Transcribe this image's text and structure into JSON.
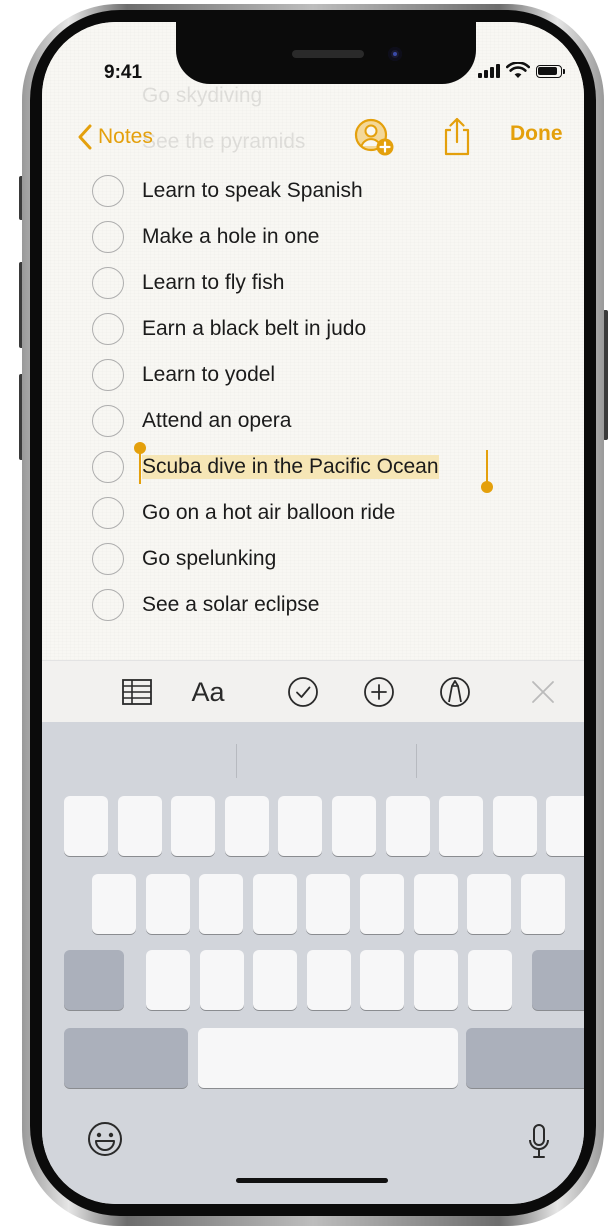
{
  "status_bar": {
    "time": "9:41"
  },
  "scrolled_items": [
    "Go skydiving",
    "See the pyramids"
  ],
  "nav": {
    "back_label": "Notes",
    "done_label": "Done"
  },
  "checklist": [
    {
      "text": "Learn to speak Spanish",
      "checked": false
    },
    {
      "text": "Make a hole in one",
      "checked": false
    },
    {
      "text": "Learn to fly fish",
      "checked": false
    },
    {
      "text": "Earn a black belt in judo",
      "checked": false
    },
    {
      "text": "Learn to yodel",
      "checked": false
    },
    {
      "text": "Attend an opera",
      "checked": false
    },
    {
      "text": "Scuba dive in the Pacific Ocean",
      "checked": false,
      "selected": true
    },
    {
      "text": "Go on a hot air balloon ride",
      "checked": false
    },
    {
      "text": "Go spelunking",
      "checked": false
    },
    {
      "text": "See a solar eclipse",
      "checked": false
    }
  ],
  "format_toolbar": {
    "text_style_label": "Aa",
    "icons": [
      "table-icon",
      "text-style-icon",
      "checklist-icon",
      "add-icon",
      "markup-icon",
      "close-icon"
    ]
  },
  "keyboard": {
    "icons": [
      "emoji-icon",
      "microphone-icon"
    ]
  },
  "colors": {
    "accent": "#e4a00c",
    "selection": "#f6e6b6",
    "paper": "#f8f7f3",
    "keyboard_bg": "#d2d5db",
    "key": "#f7f7f8",
    "key_dark": "#abb0bb"
  }
}
